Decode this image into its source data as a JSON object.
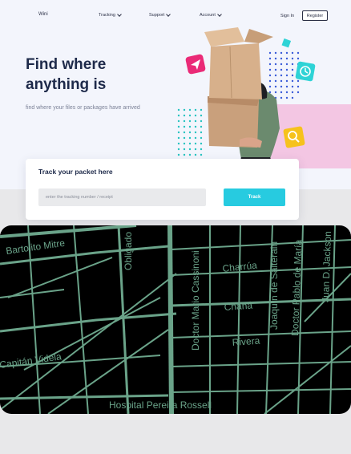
{
  "nav": {
    "logo": "Wini",
    "items": [
      {
        "label": "Tracking"
      },
      {
        "label": "Support"
      },
      {
        "label": "Account"
      }
    ],
    "signin": "Sign In",
    "register": "Register"
  },
  "hero": {
    "headline": "Find where anything is",
    "subline": "find where your files or packages have arrived"
  },
  "tracker": {
    "title": "Track your packet here",
    "placeholder": "enter the tracking number / receipt",
    "button": "Track"
  },
  "map": {
    "streets": [
      "Bartolito Mitre",
      "Obligado",
      "Doctor Mario Cassinoni",
      "Charrúa",
      "Joaquín de Salterain",
      "Doctor Pablo de María",
      "Juan D. Jackson",
      "Chaná",
      "Rivera",
      "Capitán Videla",
      "Hospital Pereira Rossell"
    ]
  },
  "colors": {
    "accent": "#27cbe0",
    "heading": "#1e2a4a",
    "map_streets": "#6aa389"
  }
}
